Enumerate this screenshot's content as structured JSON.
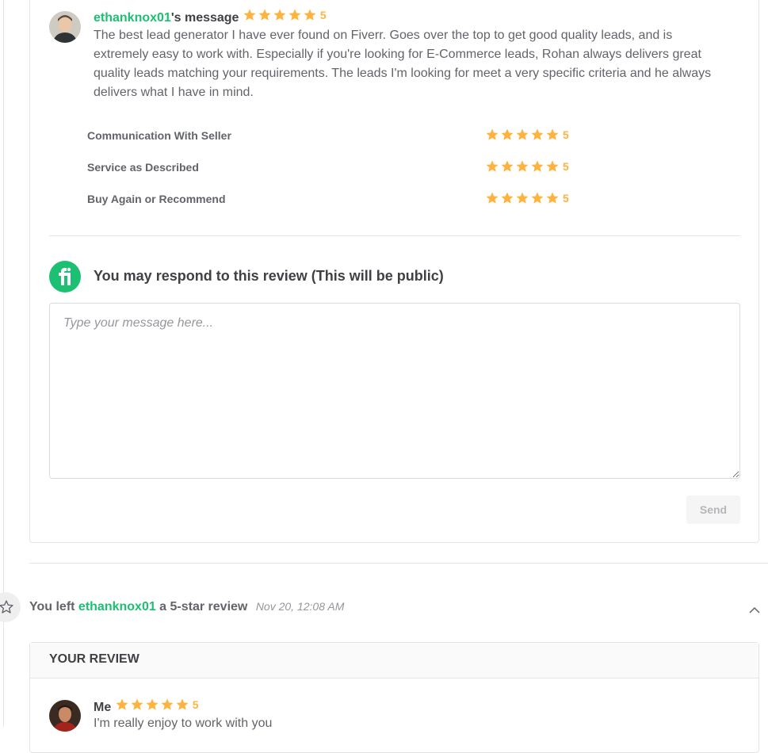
{
  "review": {
    "username": "ethanknox01",
    "message_suffix": "'s message",
    "rating": "5",
    "body": "The best lead generator I have ever found on Fiverr. Goes over the top to get good quality leads, and is extremely easy to work with. Especially if you're looking for E-Commerce leads, Rohan always delivers great quality leads matching your requirements. The leads I'm looking for meet a very specific criteria and he always delivers what I have in mind.",
    "criteria": [
      {
        "label": "Communication With Seller",
        "rating": "5"
      },
      {
        "label": "Service as Described",
        "rating": "5"
      },
      {
        "label": "Buy Again or Recommend",
        "rating": "5"
      }
    ]
  },
  "respond": {
    "title": "You may respond to this review (This will be public)",
    "placeholder": "Type your message here...",
    "send_label": "Send"
  },
  "event": {
    "prefix": "You left ",
    "username": "ethanknox01",
    "suffix": " a 5-star review",
    "time": "Nov 20, 12:08 AM"
  },
  "your_review": {
    "title": "YOUR REVIEW",
    "author": "Me",
    "rating": "5",
    "body": "I'm really enjoy to work with you"
  },
  "colors": {
    "accent": "#1dbf73",
    "star": "#ffb33e"
  }
}
